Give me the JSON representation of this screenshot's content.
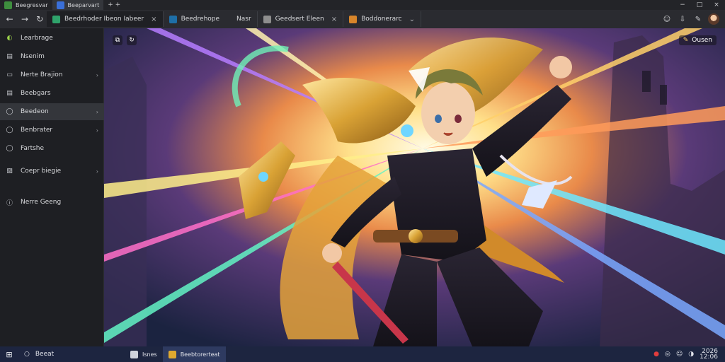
{
  "titlebar": {
    "tabs": [
      {
        "label": "Beegresvar",
        "favicon_color": "#3e8e3e",
        "active": false
      },
      {
        "label": "Beeparvart",
        "favicon_color": "#3a6fd8",
        "active": true
      }
    ],
    "newtab": "+ +",
    "controls": [
      "−",
      "□",
      "×"
    ]
  },
  "nav": {
    "buttons": [
      "←",
      "→",
      "↻"
    ],
    "tabs": [
      {
        "label": "Beedrhoder Ibeon Iabeer",
        "favicon_color": "#2fa36b",
        "close": "×",
        "active": true
      },
      {
        "label": "Beedrehope",
        "extra": "Nasr",
        "favicon_color": "#1e6fa8",
        "close": "",
        "active": false
      },
      {
        "label": "Geedsert Eleen",
        "favicon_color": "#8e8e8e",
        "close": "×",
        "active": false
      },
      {
        "label": "Boddonerarc",
        "favicon_color": "#d8852a",
        "close": "⌄",
        "active": false
      }
    ],
    "right_icons": [
      "☺",
      "⇩",
      "✎"
    ]
  },
  "sidebar": {
    "items": [
      {
        "label": "Learbrage",
        "icon": "◐",
        "icon_name": "leaf-icon",
        "chevron": false,
        "active": false,
        "accent": "#9bd24a"
      },
      {
        "label": "Nsenim",
        "icon": "▤",
        "icon_name": "home-icon",
        "chevron": false,
        "active": false
      },
      {
        "label": "Nerte Brajion",
        "icon": "▭",
        "icon_name": "folder-icon",
        "chevron": true,
        "active": false
      },
      {
        "label": "Beebgars",
        "icon": "▤",
        "icon_name": "document-icon",
        "chevron": false,
        "active": false
      },
      {
        "label": "Beedeon",
        "icon": "◯",
        "icon_name": "circle-icon",
        "chevron": true,
        "active": true
      },
      {
        "label": "Benbrater",
        "icon": "◯",
        "icon_name": "person-icon",
        "chevron": true,
        "active": false
      },
      {
        "label": "Fartshe",
        "icon": "◯",
        "icon_name": "clock-icon",
        "chevron": false,
        "active": false
      },
      {
        "label": "Coepr biegie",
        "icon": "▧",
        "icon_name": "image-icon",
        "chevron": true,
        "active": false
      },
      {
        "label": "Nerre Geeng",
        "icon": "ⓘ",
        "icon_name": "info-icon",
        "chevron": false,
        "active": false
      }
    ]
  },
  "content": {
    "overlay_left": [
      "⧉",
      "↻"
    ],
    "overlay_right": {
      "icon": "✎",
      "label": "Ousen"
    }
  },
  "taskbar": {
    "start": "⊞",
    "search": {
      "icon": "○",
      "label": "Beeat"
    },
    "apps": [
      {
        "label": "Isnes",
        "icon_color": "#cfd3dc",
        "active": false
      },
      {
        "label": "Beebtorerteat",
        "icon_color": "#e0a92f",
        "active": true
      }
    ],
    "tray": [
      "●",
      "◎",
      "☺",
      "◑"
    ],
    "clock": [
      "2026",
      "12:06"
    ]
  }
}
